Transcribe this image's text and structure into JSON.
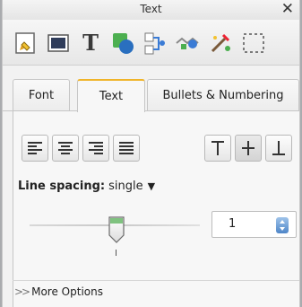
{
  "window": {
    "title": "Text",
    "close_glyph": "✕"
  },
  "toolbar": {
    "items": [
      {
        "name": "format-page-icon"
      },
      {
        "name": "format-rectangle-icon"
      },
      {
        "name": "format-text-icon",
        "glyph": "T"
      },
      {
        "name": "format-shape-icon"
      },
      {
        "name": "format-connector-icon"
      },
      {
        "name": "format-image-icon"
      },
      {
        "name": "format-effects-icon"
      },
      {
        "name": "format-selection-icon"
      }
    ]
  },
  "tabs": [
    {
      "label": "Font",
      "active": false
    },
    {
      "label": "Text",
      "active": true
    },
    {
      "label": "Bullets & Numbering",
      "active": false
    }
  ],
  "alignment": {
    "horizontal": [
      "align-left-icon",
      "align-center-icon",
      "align-right-icon",
      "align-justify-icon"
    ],
    "vertical": [
      "valign-top-icon",
      "valign-middle-icon",
      "valign-bottom-icon"
    ],
    "selected_vertical": "valign-middle-icon"
  },
  "line_spacing": {
    "label": "Line spacing:",
    "value": "single",
    "caret": "▼"
  },
  "spacing_slider": {
    "value": 1
  },
  "spacing_input": {
    "value": "1"
  },
  "footer": {
    "more_options_chevron": ">>",
    "more_options_label": "More Options"
  },
  "colors": {
    "accent_tab": "#f0b429",
    "spin_button": "#4f86c8"
  }
}
